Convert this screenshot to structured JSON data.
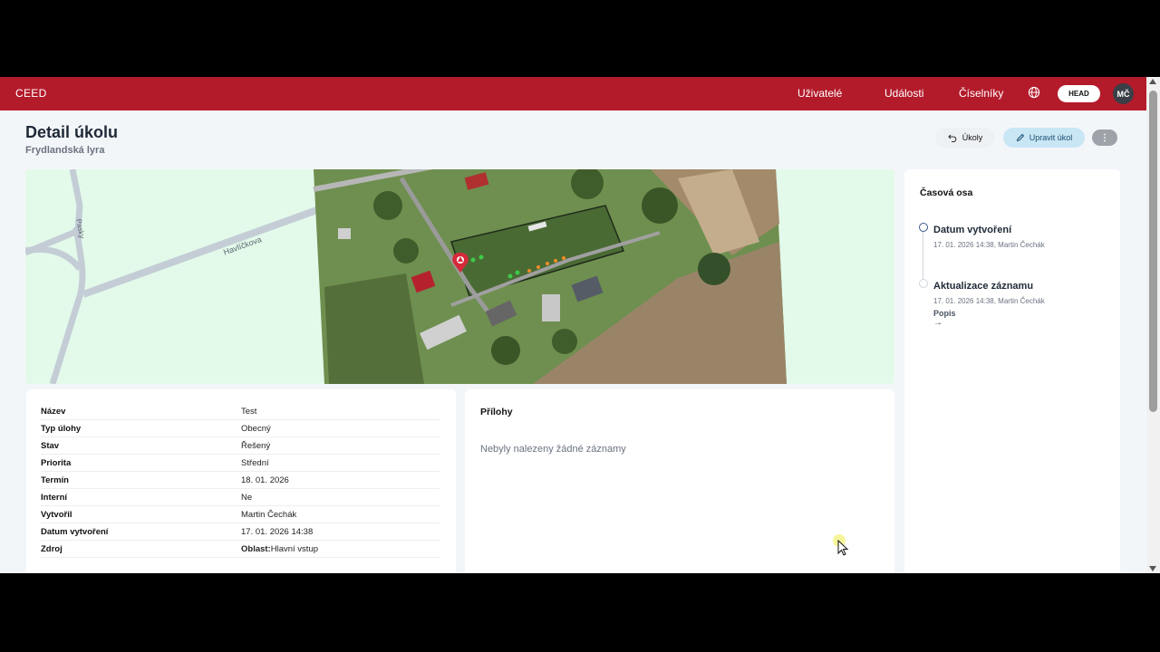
{
  "nav": {
    "brand": "CEED",
    "links": [
      "Uživatelé",
      "Události",
      "Číselníky"
    ],
    "head_label": "HEAD",
    "avatar_initials": "MČ",
    "accent": "#b31b2b"
  },
  "header": {
    "title": "Detail úkolu",
    "subtitle": "Frydlandská lyra",
    "back_label": "Úkoly",
    "edit_label": "Upravit úkol"
  },
  "map": {
    "street_labels": [
      "Havlíčkova",
      "Pasky"
    ]
  },
  "details": {
    "rows": [
      {
        "label": "Název",
        "value": "Test"
      },
      {
        "label": "Typ úlohy",
        "value": "Obecný"
      },
      {
        "label": "Stav",
        "value": "Řešený"
      },
      {
        "label": "Priorita",
        "value": "Střední"
      },
      {
        "label": "Termín",
        "value": "18. 01. 2026"
      },
      {
        "label": "Interní",
        "value": "Ne"
      },
      {
        "label": "Vytvořil",
        "value": "Martin Čechák"
      },
      {
        "label": "Datum vytvoření",
        "value": "17. 01. 2026 14:38"
      },
      {
        "label": "Zdroj",
        "value_prefix": "Oblast:",
        "value": "Hlavní vstup"
      }
    ]
  },
  "attachments": {
    "title": "Přílohy",
    "empty_text": "Nebyly nalezeny žádné záznamy"
  },
  "timeline": {
    "title": "Časová osa",
    "events": [
      {
        "title": "Datum vytvoření",
        "meta": "17. 01. 2026 14:38, Martin Čechák",
        "dot_color": "#3b5b8a"
      },
      {
        "title": "Aktualizace záznamu",
        "meta": "17. 01. 2026 14:38, Martin Čechák",
        "link": "Popis",
        "arrow": "→",
        "dot_color": "#d1d5db"
      }
    ]
  }
}
